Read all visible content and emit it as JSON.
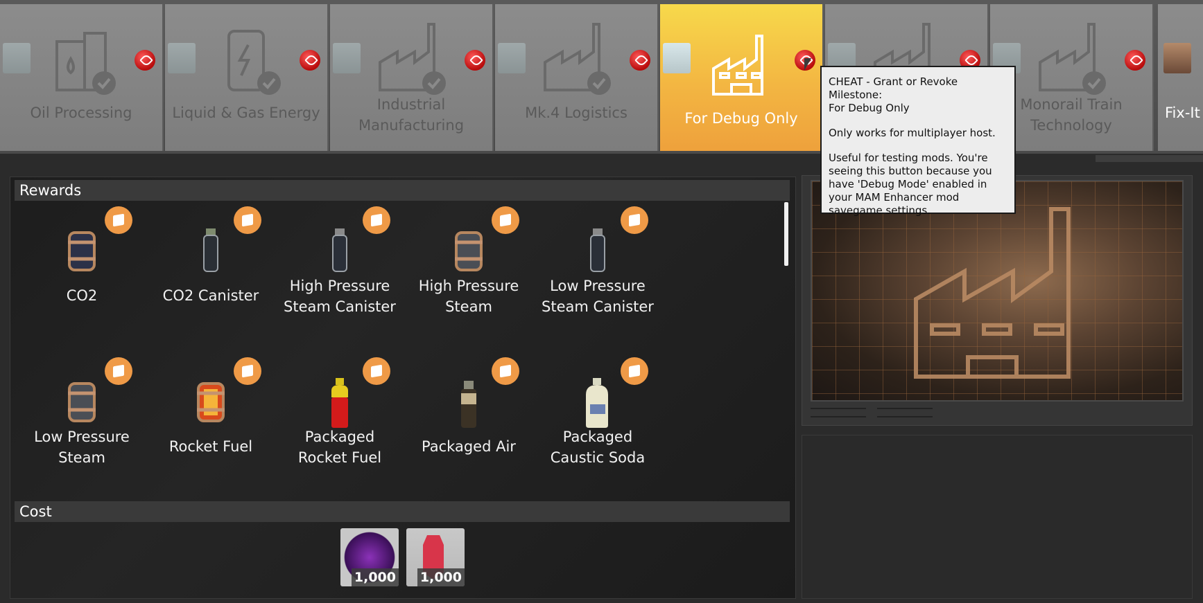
{
  "milestones": [
    {
      "label": "Oil Processing"
    },
    {
      "label": "Liquid & Gas Energy"
    },
    {
      "label": "Industrial\nManufacturing"
    },
    {
      "label": "Mk.4 Logistics"
    },
    {
      "label": "For Debug Only"
    },
    {
      "label": ""
    },
    {
      "label": "Monorail Train\nTechnology"
    },
    {
      "label": "Fix-It"
    }
  ],
  "rewards": {
    "title": "Rewards",
    "items": [
      {
        "label": "CO2"
      },
      {
        "label": "CO2 Canister"
      },
      {
        "label": "High Pressure\nSteam Canister"
      },
      {
        "label": "High Pressure\nSteam"
      },
      {
        "label": "Low Pressure\nSteam Canister"
      },
      {
        "label": "Low Pressure\nSteam"
      },
      {
        "label": "Rocket Fuel"
      },
      {
        "label": "Packaged\nRocket Fuel"
      },
      {
        "label": "Packaged Air"
      },
      {
        "label": "Packaged\nCaustic Soda"
      }
    ]
  },
  "cost": {
    "title": "Cost",
    "items": [
      {
        "qty": "1,000"
      },
      {
        "qty": "1,000"
      }
    ]
  },
  "tooltip": {
    "title": "CHEAT - Grant or Revoke Milestone:",
    "subtitle": "For Debug Only",
    "line2": "Only works for multiplayer host.",
    "line3": "Useful for testing mods. You're seeing this button because you have 'Debug Mode' enabled in your MAM Enhancer mod savegame settings."
  },
  "colors": {
    "active_tab": "#f3b642",
    "unlock_badge": "#ef9a47",
    "cheat_icon": "#d61515"
  },
  "icons": [
    "cheat-rocket-icon",
    "mod-badge-icon",
    "factory-icon",
    "unlock-box-icon"
  ]
}
